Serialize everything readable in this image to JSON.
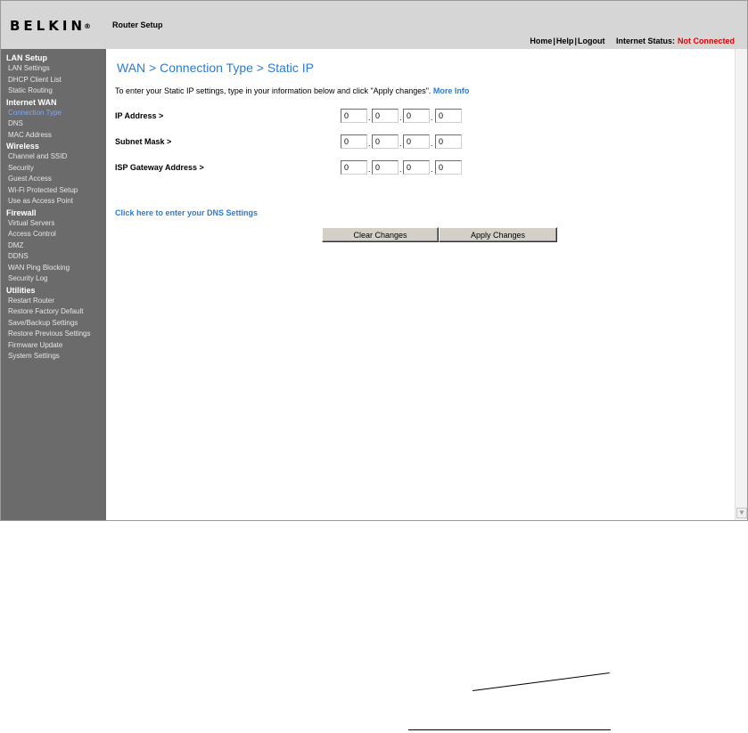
{
  "header": {
    "logo_text": "BELKIN",
    "logo_mark": "®",
    "title": "Router Setup",
    "links": [
      "Home",
      "Help",
      "Logout"
    ],
    "link_separator": "|",
    "status_label": "Internet Status:",
    "status_value": "Not Connected",
    "status_color": "#e00000"
  },
  "sidebar": {
    "sections": [
      {
        "heading": "LAN Setup",
        "items": [
          "LAN Settings",
          "DHCP Client List",
          "Static Routing"
        ]
      },
      {
        "heading": "Internet WAN",
        "items": [
          "Connection Type",
          "DNS",
          "MAC Address"
        ]
      },
      {
        "heading": "Wireless",
        "items": [
          "Channel and SSID",
          "Security",
          "Guest Access",
          "Wi-Fi Protected Setup",
          "Use as Access Point"
        ]
      },
      {
        "heading": "Firewall",
        "items": [
          "Virtual Servers",
          "Access Control",
          "DMZ",
          "DDNS",
          "WAN Ping Blocking",
          "Security Log"
        ]
      },
      {
        "heading": "Utilities",
        "items": [
          "Restart Router",
          "Restore Factory Default",
          "Save/Backup Settings",
          "Restore Previous Settings",
          "Firmware Update",
          "System Settings"
        ]
      }
    ],
    "active_item": "Connection Type"
  },
  "main": {
    "title": "WAN > Connection Type > Static IP",
    "intro": "To enter your Static IP settings, type in your information below and click \"Apply changes\".",
    "more_info": "More Info",
    "fields": [
      {
        "label": "IP Address >",
        "octets": [
          "0",
          "0",
          "0",
          "0"
        ]
      },
      {
        "label": "Subnet Mask >",
        "octets": [
          "0",
          "0",
          "0",
          "0"
        ]
      },
      {
        "label": "ISP Gateway Address >",
        "octets": [
          "0",
          "0",
          "0",
          "0"
        ]
      }
    ],
    "octet_separator": ".",
    "dns_link": "Click here to enter your DNS Settings",
    "clear_button": "Clear Changes",
    "apply_button": "Apply Changes"
  },
  "scrollbar": {
    "down_icon": "scroll-down-arrow-icon",
    "glyph": "▼"
  },
  "accent_color": "#2c7bd0"
}
